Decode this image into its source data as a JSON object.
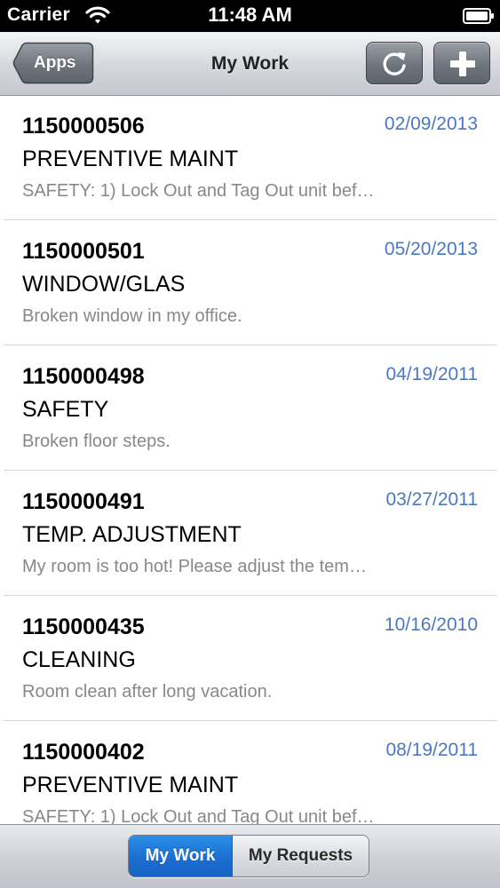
{
  "status_bar": {
    "carrier": "Carrier",
    "time": "11:48 AM",
    "icons": [
      "wifi-icon",
      "battery-icon"
    ]
  },
  "nav": {
    "back_label": "Apps",
    "title": "My Work",
    "refresh_icon": "refresh-icon",
    "add_icon": "plus-icon"
  },
  "items": [
    {
      "number": "1150000506",
      "date": "02/09/2013",
      "category": "PREVENTIVE MAINT",
      "description": "SAFETY: 1) Lock Out and Tag Out unit bef…"
    },
    {
      "number": "1150000501",
      "date": "05/20/2013",
      "category": "WINDOW/GLAS",
      "description": "Broken window in my office."
    },
    {
      "number": "1150000498",
      "date": "04/19/2011",
      "category": "SAFETY",
      "description": "Broken floor steps."
    },
    {
      "number": "1150000491",
      "date": "03/27/2011",
      "category": "TEMP. ADJUSTMENT",
      "description": "My room is too hot! Please adjust the tem…"
    },
    {
      "number": "1150000435",
      "date": "10/16/2010",
      "category": "CLEANING",
      "description": "Room clean after long vacation."
    },
    {
      "number": "1150000402",
      "date": "08/19/2011",
      "category": "PREVENTIVE MAINT",
      "description": "SAFETY: 1) Lock Out and Tag Out unit bef…"
    }
  ],
  "tabs": {
    "active": "My Work",
    "inactive": "My Requests"
  },
  "colors": {
    "date": "#4a78c2",
    "active_tab": "#1b6fd2",
    "description": "#888888"
  }
}
